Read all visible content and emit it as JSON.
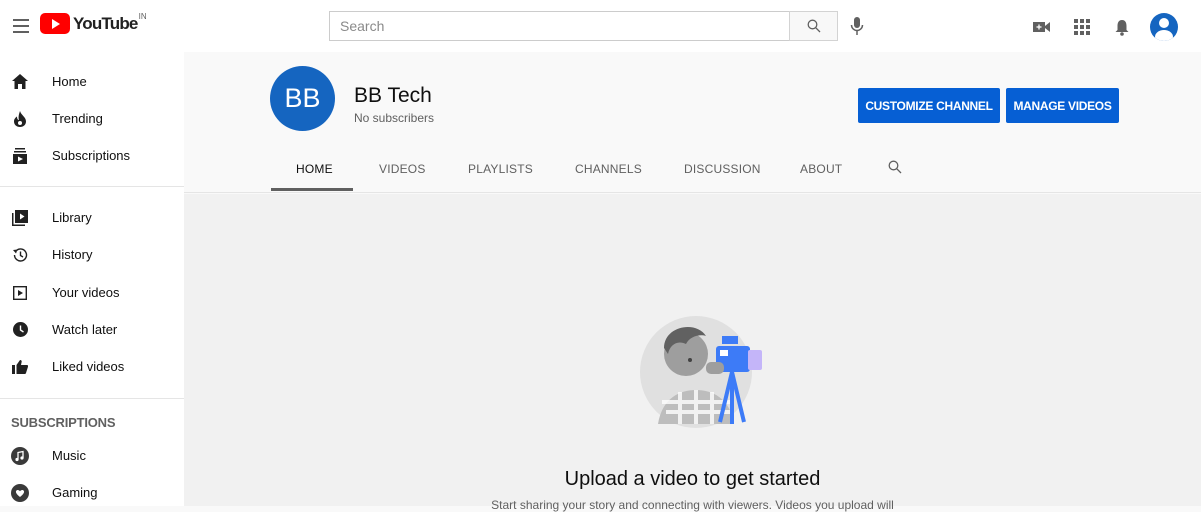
{
  "topbar": {
    "logo_text": "YouTube",
    "logo_region": "IN",
    "search_placeholder": "Search"
  },
  "sidebar": {
    "items": [
      {
        "label": "Home",
        "icon": "home-icon"
      },
      {
        "label": "Trending",
        "icon": "flame-icon"
      },
      {
        "label": "Subscriptions",
        "icon": "subscriptions-icon"
      },
      {
        "label": "Library",
        "icon": "library-icon"
      },
      {
        "label": "History",
        "icon": "history-icon"
      },
      {
        "label": "Your videos",
        "icon": "play-box-icon"
      },
      {
        "label": "Watch later",
        "icon": "clock-icon"
      },
      {
        "label": "Liked videos",
        "icon": "thumbs-up-icon"
      }
    ],
    "subscriptions_heading": "SUBSCRIPTIONS",
    "subscriptions": [
      {
        "label": "Music",
        "icon": "music-icon"
      },
      {
        "label": "Gaming",
        "icon": "gaming-icon"
      }
    ]
  },
  "channel": {
    "avatar_initials": "BB",
    "name": "BB Tech",
    "subscribers": "No subscribers",
    "customize_label": "CUSTOMIZE CHANNEL",
    "manage_label": "MANAGE VIDEOS",
    "tabs": [
      "HOME",
      "VIDEOS",
      "PLAYLISTS",
      "CHANNELS",
      "DISCUSSION",
      "ABOUT"
    ],
    "active_tab": "HOME"
  },
  "empty_state": {
    "title": "Upload a video to get started",
    "subtitle": "Start sharing your story and connecting with viewers. Videos you upload will"
  },
  "colors": {
    "accent_blue": "#065fd4",
    "avatar_blue": "#1565c0",
    "brand_red": "#ff0000"
  }
}
